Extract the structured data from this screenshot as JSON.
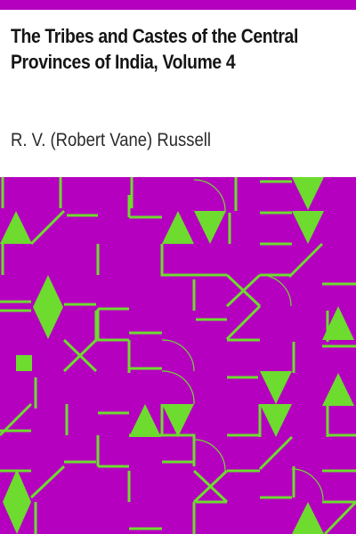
{
  "cover": {
    "title": "The Tribes and Castes of the Central Provinces of India, Volume 4",
    "author": "R. V. (Robert Vane) Russell",
    "colors": {
      "top_bar": "#b500c0",
      "pattern_background": "#b500c0",
      "pattern_foreground": "#6ddc2e",
      "page_background": "#ffffff",
      "text": "#151515"
    },
    "pattern_icons": [
      "triangle-up-icon",
      "triangle-down-icon",
      "diamond-icon",
      "cross-icon",
      "square-icon",
      "arc-icon"
    ]
  }
}
